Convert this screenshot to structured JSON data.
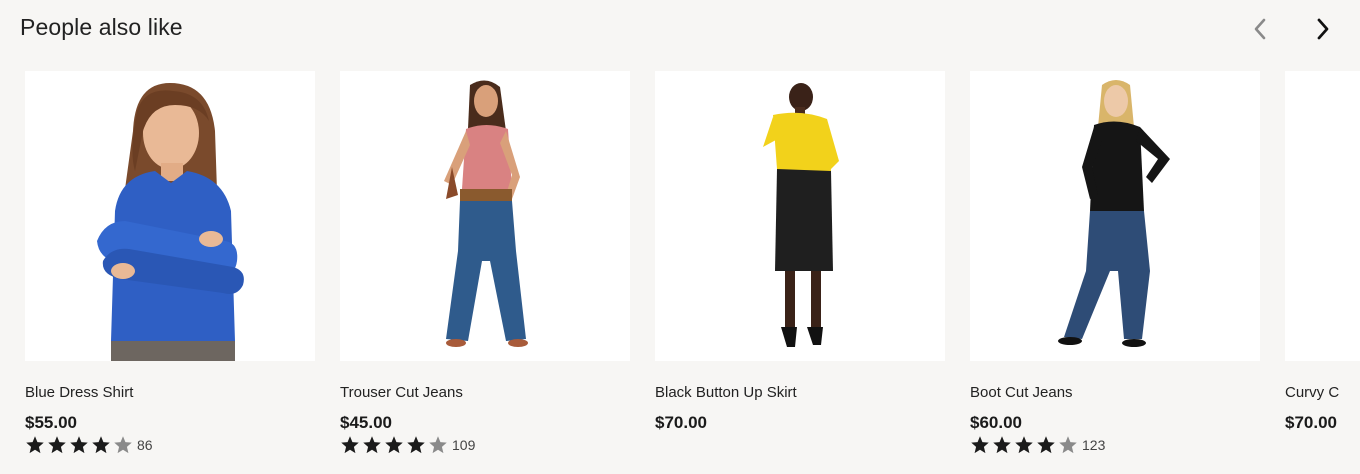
{
  "section": {
    "title": "People also like"
  },
  "nav": {
    "prev_icon": "chevron-left-icon",
    "next_icon": "chevron-right-icon"
  },
  "colors": {
    "background": "#f7f6f4",
    "star_filled": "#1b1b1b",
    "star_empty": "#8a8a8a",
    "nav_disabled": "#8a8a8a",
    "nav_active": "#111111"
  },
  "products": [
    {
      "name": "Blue Dress Shirt",
      "price": "$55.00",
      "rating": 4,
      "reviews": "86"
    },
    {
      "name": "Trouser Cut Jeans",
      "price": "$45.00",
      "rating": 4,
      "reviews": "109"
    },
    {
      "name": "Black Button Up Skirt",
      "price": "$70.00"
    },
    {
      "name": "Boot Cut Jeans",
      "price": "$60.00",
      "rating": 4,
      "reviews": "123"
    },
    {
      "name": "Curvy C",
      "price": "$70.00"
    }
  ]
}
